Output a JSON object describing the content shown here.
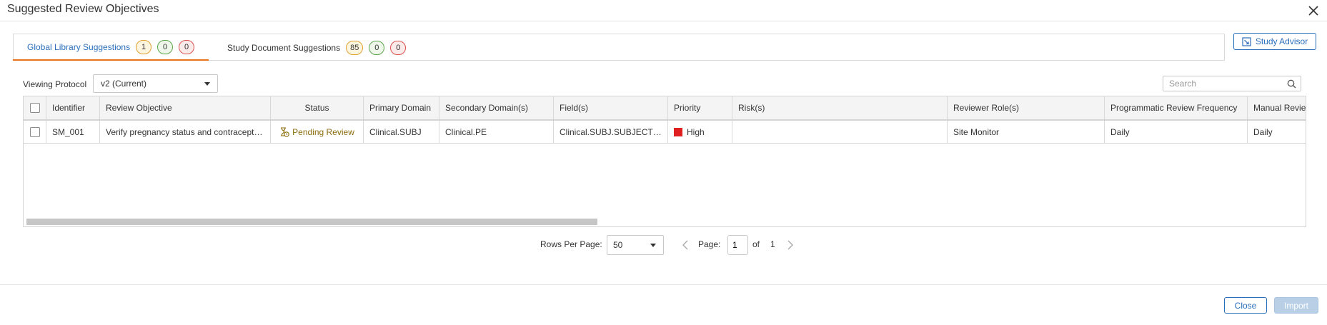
{
  "dialog": {
    "title": "Suggested Review Objectives"
  },
  "tabs": [
    {
      "label": "Global Library Suggestions",
      "counts": [
        "1",
        "0",
        "0"
      ],
      "active": true
    },
    {
      "label": "Study Document Suggestions",
      "counts": [
        "85",
        "0",
        "0"
      ],
      "active": false
    }
  ],
  "study_advisor": {
    "label": "Study Advisor"
  },
  "viewing_protocol": {
    "label": "Viewing Protocol",
    "value": "v2 (Current)"
  },
  "search": {
    "placeholder": "Search"
  },
  "table": {
    "columns": [
      "Identifier",
      "Review Objective",
      "Status",
      "Primary Domain",
      "Secondary Domain(s)",
      "Field(s)",
      "Priority",
      "Risk(s)",
      "Reviewer Role(s)",
      "Programmatic Review Frequency",
      "Manual Review"
    ],
    "rows": [
      {
        "identifier": "SM_001",
        "review_objective": "Verify pregnancy status and contraception",
        "status": "Pending Review",
        "primary_domain": "Clinical.SUBJ",
        "secondary_domains": "Clinical.PE",
        "fields": "Clinical.SUBJ.SUBJECTID...",
        "priority": "High",
        "risks": "",
        "reviewer_roles": "Site Monitor",
        "programmatic_frequency": "Daily",
        "manual_frequency": "Daily"
      }
    ],
    "scroll_fraction": 0.45
  },
  "pagination": {
    "rows_per_page_label": "Rows Per Page:",
    "rows_per_page": "50",
    "page_label": "Page:",
    "page": "1",
    "of_label": "of",
    "total_pages": "1"
  },
  "footer": {
    "close_label": "Close",
    "import_label": "Import"
  },
  "colors": {
    "accent": "#2a6ebb",
    "active_tab_underline": "#e5731f",
    "priority_high": "#e02020",
    "status_pending": "#8a6d0b"
  }
}
